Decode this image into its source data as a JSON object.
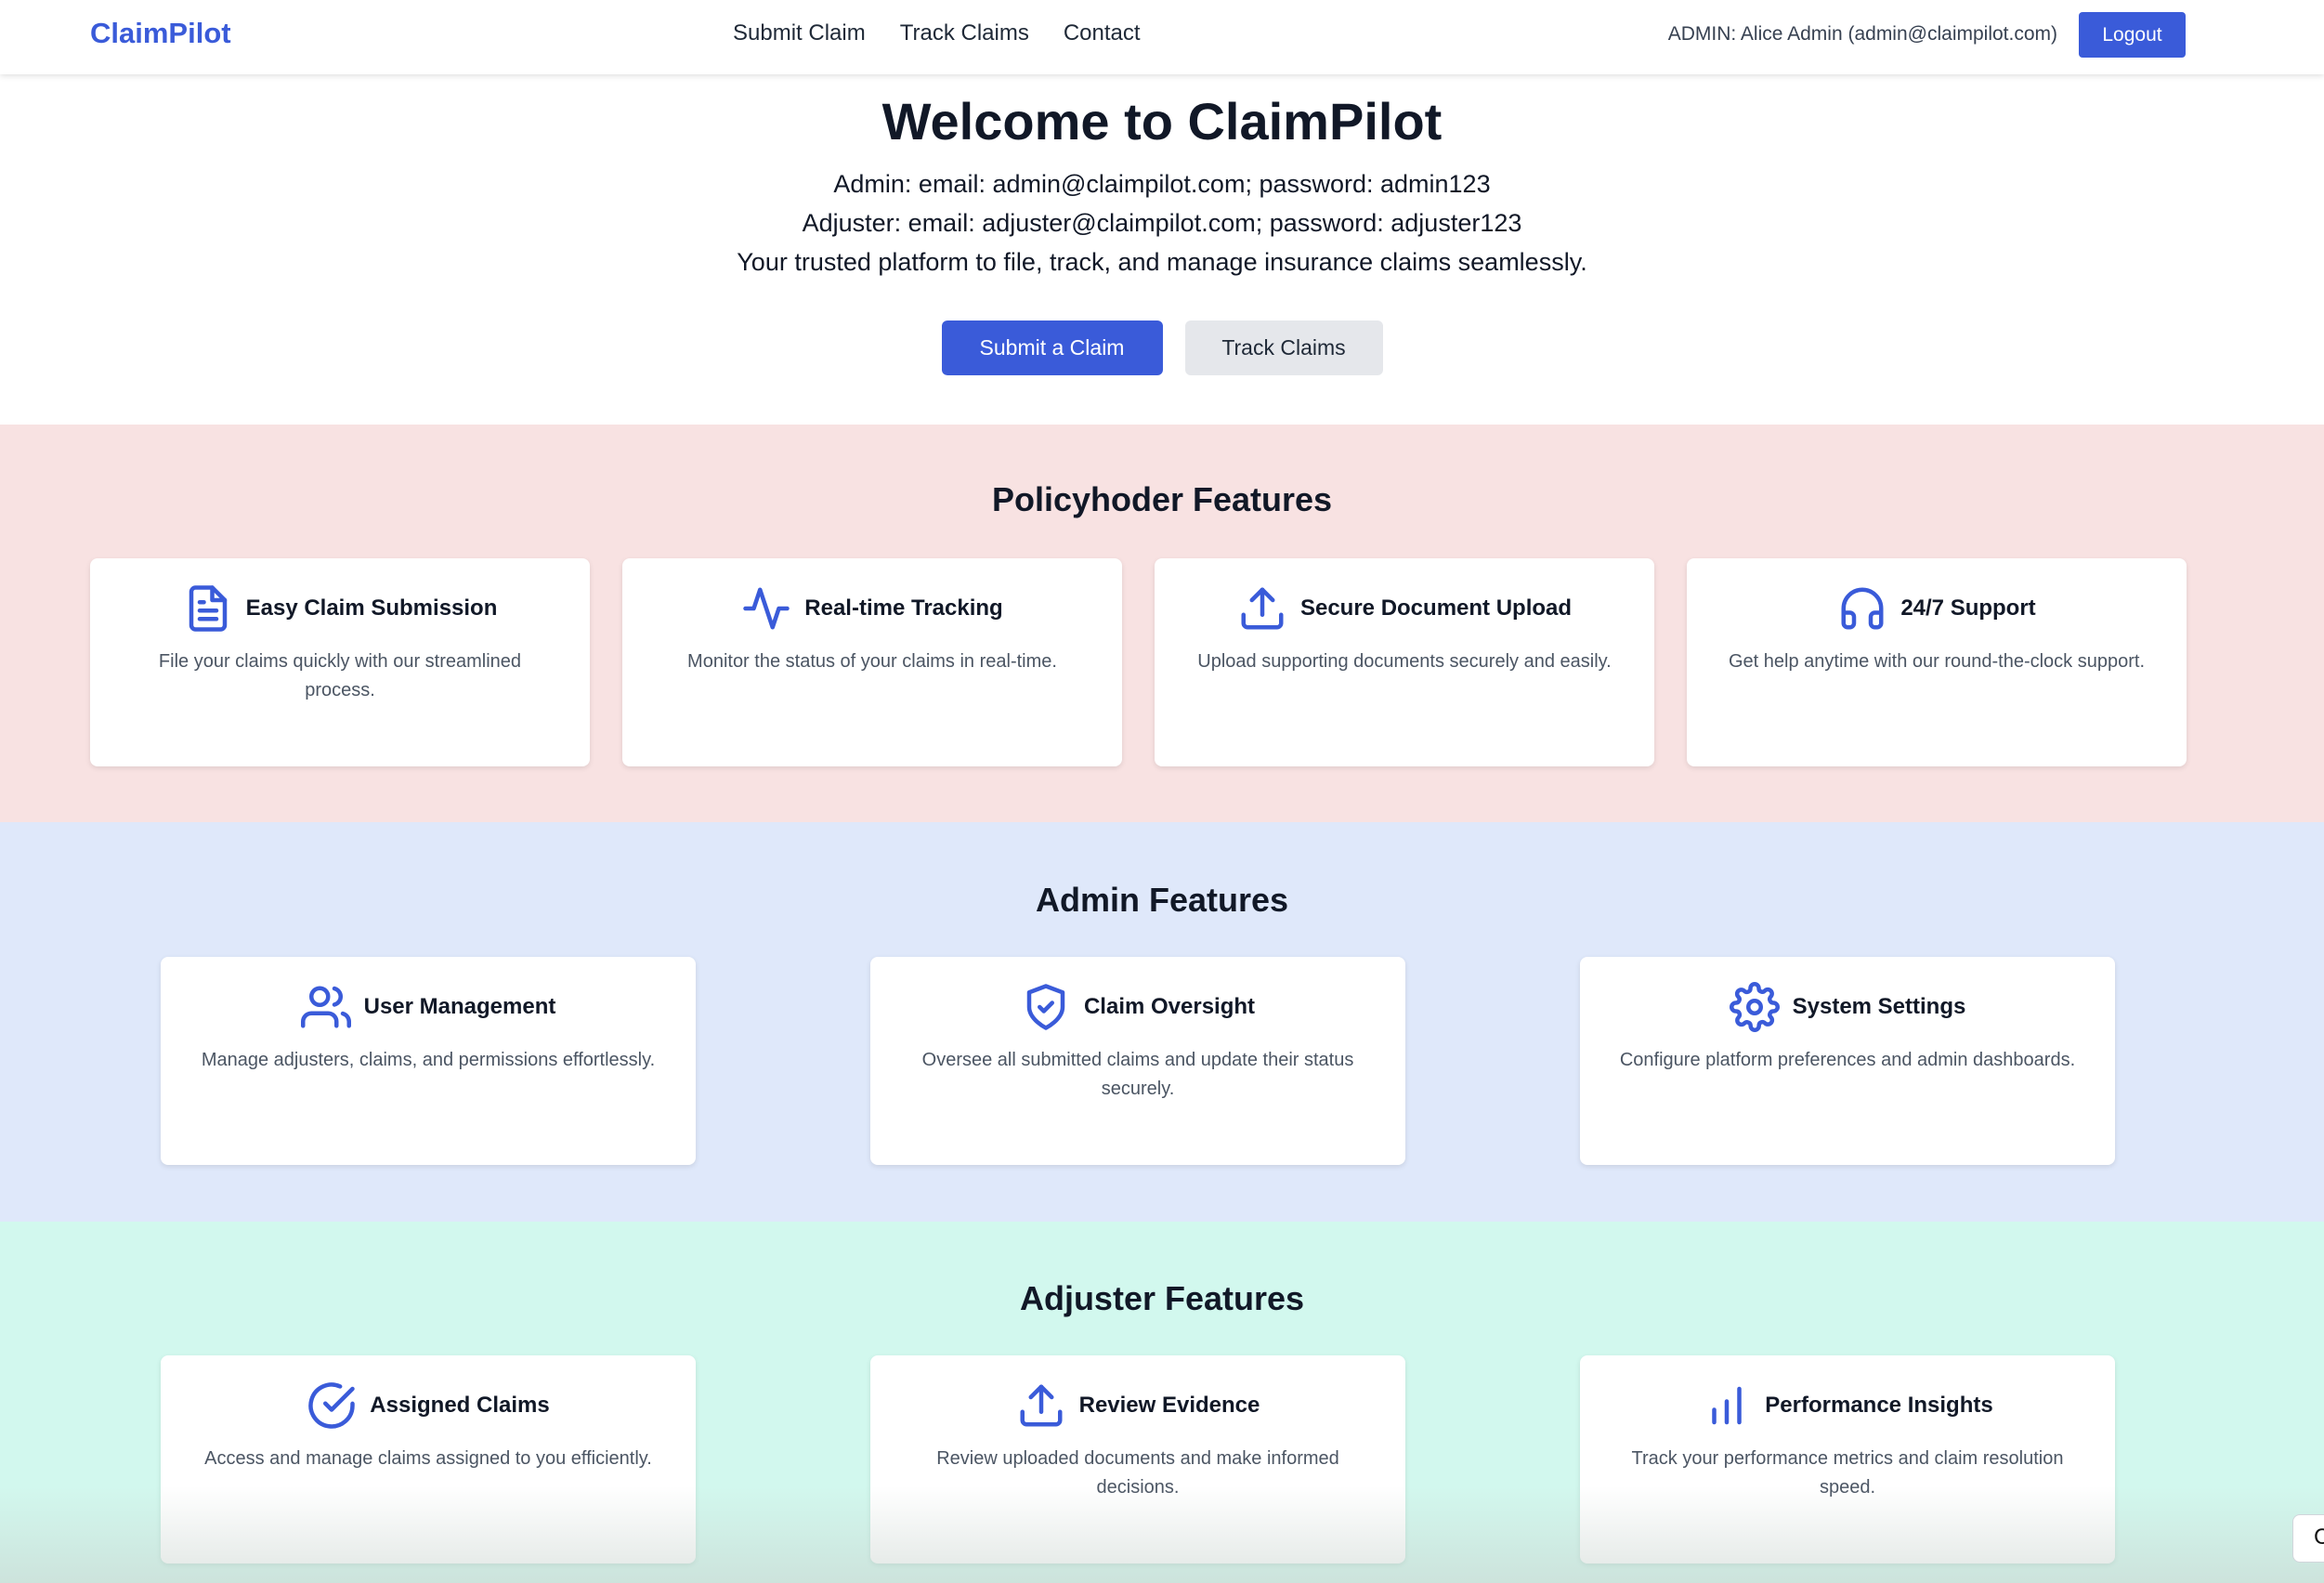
{
  "nav": {
    "brand": "ClaimPilot",
    "links": [
      "Submit Claim",
      "Track Claims",
      "Contact"
    ],
    "user": "ADMIN: Alice Admin (admin@claimpilot.com)",
    "logout": "Logout"
  },
  "hero": {
    "title": "Welcome to ClaimPilot",
    "line1": "Admin: email: admin@claimpilot.com; password: admin123",
    "line2": "Adjuster: email: adjuster@claimpilot.com; password: adjuster123",
    "line3": "Your trusted platform to file, track, and manage insurance claims seamlessly.",
    "primary_button": "Submit a Claim",
    "secondary_button": "Track Claims"
  },
  "policyholder": {
    "title": "Policyhoder Features",
    "bg": "#f8e2e2",
    "cards": [
      {
        "icon": "document-icon",
        "title": "Easy Claim Submission",
        "desc": "File your claims quickly with our streamlined process."
      },
      {
        "icon": "activity-icon",
        "title": "Real-time Tracking",
        "desc": "Monitor the status of your claims in real-time."
      },
      {
        "icon": "upload-icon",
        "title": "Secure Document Upload",
        "desc": "Upload supporting documents securely and easily."
      },
      {
        "icon": "headphones-icon",
        "title": "24/7 Support",
        "desc": "Get help anytime with our round-the-clock support."
      }
    ]
  },
  "admin": {
    "title": "Admin Features",
    "bg": "#dfe8fa",
    "cards": [
      {
        "icon": "users-icon",
        "title": "User Management",
        "desc": "Manage adjusters, claims, and permissions effortlessly."
      },
      {
        "icon": "shield-check-icon",
        "title": "Claim Oversight",
        "desc": "Oversee all submitted claims and update their status securely."
      },
      {
        "icon": "gear-icon",
        "title": "System Settings",
        "desc": "Configure platform preferences and admin dashboards."
      }
    ]
  },
  "adjuster": {
    "title": "Adjuster Features",
    "bg": "#d2f8ee",
    "cards": [
      {
        "icon": "check-circle-icon",
        "title": "Assigned Claims",
        "desc": "Access and manage claims assigned to you efficiently."
      },
      {
        "icon": "upload-icon",
        "title": "Review Evidence",
        "desc": "Review uploaded documents and make informed decisions."
      },
      {
        "icon": "bar-chart-icon",
        "title": "Performance Insights",
        "desc": "Track your performance metrics and claim resolution speed."
      }
    ]
  },
  "corner_widget": "C",
  "accent_color": "#3a5bd9"
}
